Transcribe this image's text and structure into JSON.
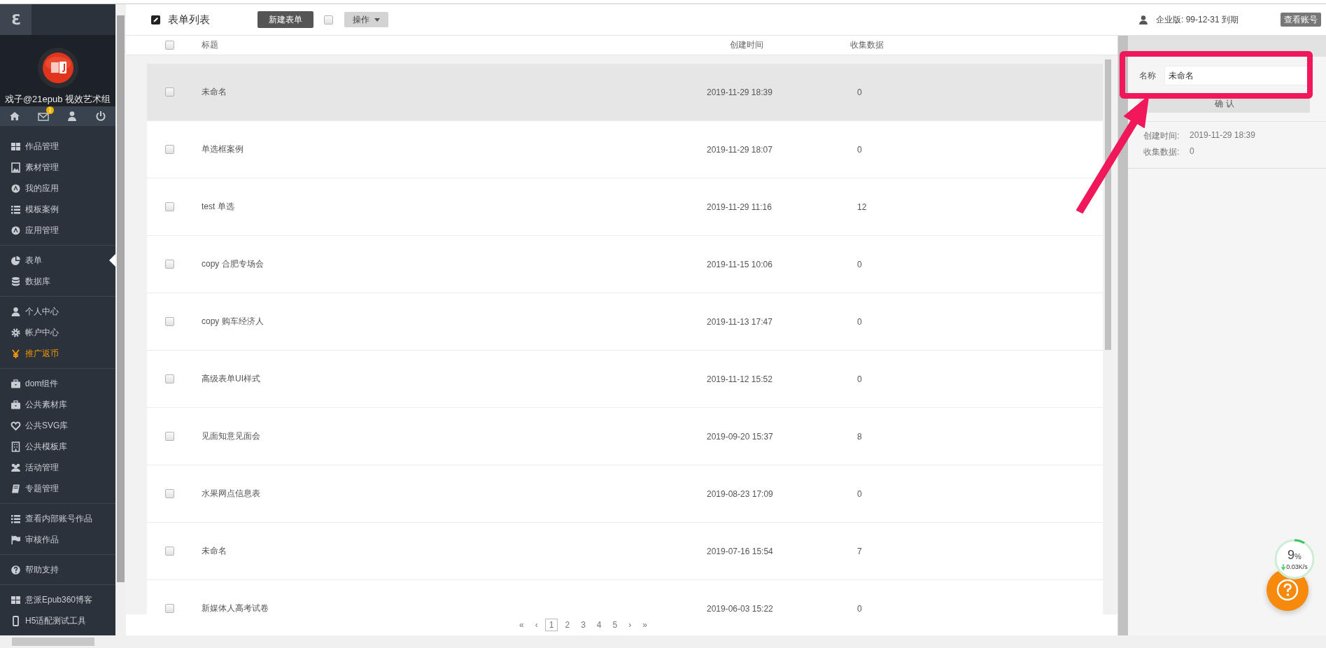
{
  "sidebar": {
    "logo": "ℇ",
    "user_name": "戏子@21epub 视效艺术组",
    "toolbar": [
      {
        "badge": false
      },
      {
        "badge": true
      },
      {
        "badge": false
      },
      {
        "badge": false
      }
    ],
    "groups": [
      {
        "items": [
          {
            "label": "作品管理",
            "selected": false,
            "color": "#c9cdd1"
          },
          {
            "label": "素材管理",
            "selected": false,
            "color": "#c9cdd1"
          },
          {
            "label": "我的应用",
            "selected": false,
            "color": "#c9cdd1"
          },
          {
            "label": "模板案例",
            "selected": false,
            "color": "#c9cdd1"
          },
          {
            "label": "应用管理",
            "selected": false,
            "color": "#c9cdd1"
          }
        ]
      },
      {
        "items": [
          {
            "label": "表单",
            "selected": true,
            "color": "#c9cdd1"
          },
          {
            "label": "数据库",
            "selected": false,
            "color": "#c9cdd1"
          }
        ]
      },
      {
        "items": [
          {
            "label": "个人中心",
            "selected": false,
            "color": "#c9cdd1"
          },
          {
            "label": "帐户中心",
            "selected": false,
            "color": "#c9cdd1"
          },
          {
            "label": "推广返币",
            "selected": false,
            "color": "#f39800"
          }
        ]
      },
      {
        "items": [
          {
            "label": "dom组件",
            "selected": false,
            "color": "#c9cdd1"
          },
          {
            "label": "公共素材库",
            "selected": false,
            "color": "#c9cdd1"
          },
          {
            "label": "公共SVG库",
            "selected": false,
            "color": "#c9cdd1"
          },
          {
            "label": "公共模板库",
            "selected": false,
            "color": "#c9cdd1"
          },
          {
            "label": "活动管理",
            "selected": false,
            "color": "#c9cdd1"
          },
          {
            "label": "专题管理",
            "selected": false,
            "color": "#c9cdd1"
          }
        ]
      },
      {
        "items": [
          {
            "label": "查看内部账号作品",
            "selected": false,
            "color": "#c9cdd1"
          },
          {
            "label": "审核作品",
            "selected": false,
            "color": "#c9cdd1"
          }
        ]
      },
      {
        "items": [
          {
            "label": "帮助支持",
            "selected": false,
            "color": "#c9cdd1"
          }
        ]
      },
      {
        "items": [
          {
            "label": "意派Epub360博客",
            "selected": false,
            "color": "#c9cdd1"
          },
          {
            "label": "H5适配测试工具",
            "selected": false,
            "color": "#c9cdd1"
          }
        ]
      }
    ]
  },
  "header": {
    "title": "表单列表",
    "new_button": "新建表单",
    "select_all": false,
    "actions_button": "操作",
    "account": "企业版: 99-12-31 到期",
    "account_button": "查看账号"
  },
  "table": {
    "columns": [
      "标题",
      "创建时间",
      "收集数据"
    ],
    "header_checked": false,
    "rows": [
      {
        "title": "未命名",
        "created": "2019-11-29 18:39",
        "count": "0",
        "selected": true,
        "checked": false
      },
      {
        "title": "单选框案例",
        "created": "2019-11-29 18:07",
        "count": "0",
        "selected": false,
        "checked": false
      },
      {
        "title": "test  单选",
        "created": "2019-11-29 11:16",
        "count": "12",
        "selected": false,
        "checked": false
      },
      {
        "title": "copy  合肥专场会",
        "created": "2019-11-15 10:06",
        "count": "0",
        "selected": false,
        "checked": false
      },
      {
        "title": "copy  购车经济人",
        "created": "2019-11-13 17:47",
        "count": "0",
        "selected": false,
        "checked": false
      },
      {
        "title": "高级表单UI样式",
        "created": "2019-11-12 15:52",
        "count": "0",
        "selected": false,
        "checked": false
      },
      {
        "title": "见面知意见面会",
        "created": "2019-09-20 15:37",
        "count": "8",
        "selected": false,
        "checked": false
      },
      {
        "title": "水果网点信息表",
        "created": "2019-08-23 17:09",
        "count": "0",
        "selected": false,
        "checked": false
      },
      {
        "title": "未命名",
        "created": "2019-07-16 15:54",
        "count": "7",
        "selected": false,
        "checked": false
      },
      {
        "title": "新媒体人高考试卷",
        "created": "2019-06-03 15:22",
        "count": "0",
        "selected": false,
        "checked": false
      }
    ]
  },
  "pagination": [
    {
      "label": "«",
      "selected": false
    },
    {
      "label": "‹",
      "selected": false
    },
    {
      "label": "1",
      "selected": true
    },
    {
      "label": "2",
      "selected": false
    },
    {
      "label": "3",
      "selected": false
    },
    {
      "label": "4",
      "selected": false
    },
    {
      "label": "5",
      "selected": false
    },
    {
      "label": "›",
      "selected": false
    },
    {
      "label": "»",
      "selected": false
    }
  ],
  "info_panel": {
    "name_label": "名称",
    "name_value": "未命名",
    "confirm_button": "确 认",
    "fields": [
      {
        "label": "创建时间:",
        "value": "2019-11-29 18:39"
      },
      {
        "label": "收集数据:",
        "value": "0"
      }
    ]
  },
  "speed_widget": {
    "percent": "9",
    "unit": "%",
    "speed": "0.03K/s"
  }
}
